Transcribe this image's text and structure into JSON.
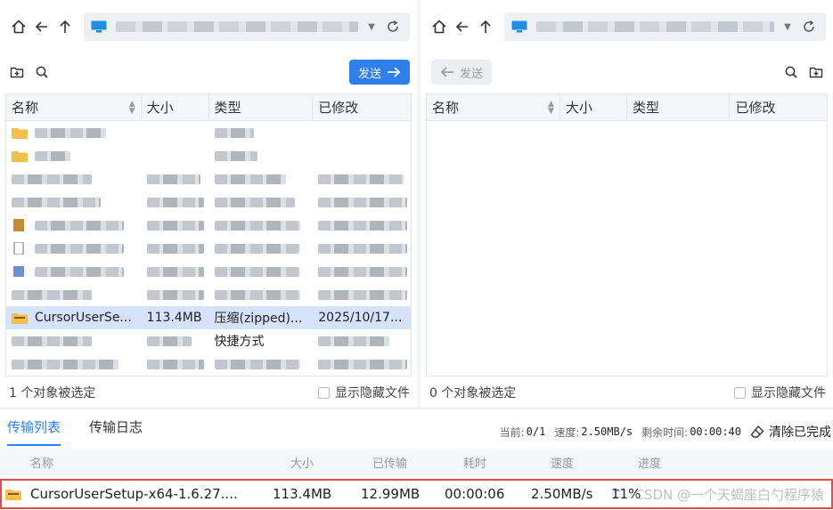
{
  "left_pane": {
    "send_label": "发送",
    "columns": [
      "名称",
      "大小",
      "类型",
      "已修改"
    ],
    "selected_file": {
      "name": "CursorUserSe...",
      "size": "113.4MB",
      "type": "压缩(zipped)...",
      "modified": "2025/10/17..."
    },
    "partial_text_row10_type": "快捷方式",
    "status": "1 个对象被选定",
    "show_hidden": "显示隐藏文件"
  },
  "right_pane": {
    "send_label": "发送",
    "columns": [
      "名称",
      "大小",
      "类型",
      "已修改"
    ],
    "status": "0 个对象被选定",
    "show_hidden": "显示隐藏文件"
  },
  "transfer": {
    "tabs": [
      "传输列表",
      "传输日志"
    ],
    "current_label": "当前:",
    "current_value": "0/1",
    "speed_label": "速度:",
    "speed_value": "2.50MB/s",
    "remaining_label": "剩余时间:",
    "remaining_value": "00:00:40",
    "clear_label": "清除已完成",
    "columns": [
      "名称",
      "大小",
      "已传输",
      "耗时",
      "速度",
      "进度"
    ],
    "item": {
      "name": "CursorUserSetup-x64-1.6.27....",
      "size": "113.4MB",
      "transferred": "12.99MB",
      "elapsed": "00:00:06",
      "speed": "2.50MB/s",
      "progress": "11%",
      "progress_fraction": 0.11
    },
    "watermark": "CSDN @一个天蝎座白勺程序猿"
  },
  "colors": {
    "accent": "#2f80ed",
    "selection": "#d4e2fb",
    "highlight_border": "#e84a4a"
  }
}
